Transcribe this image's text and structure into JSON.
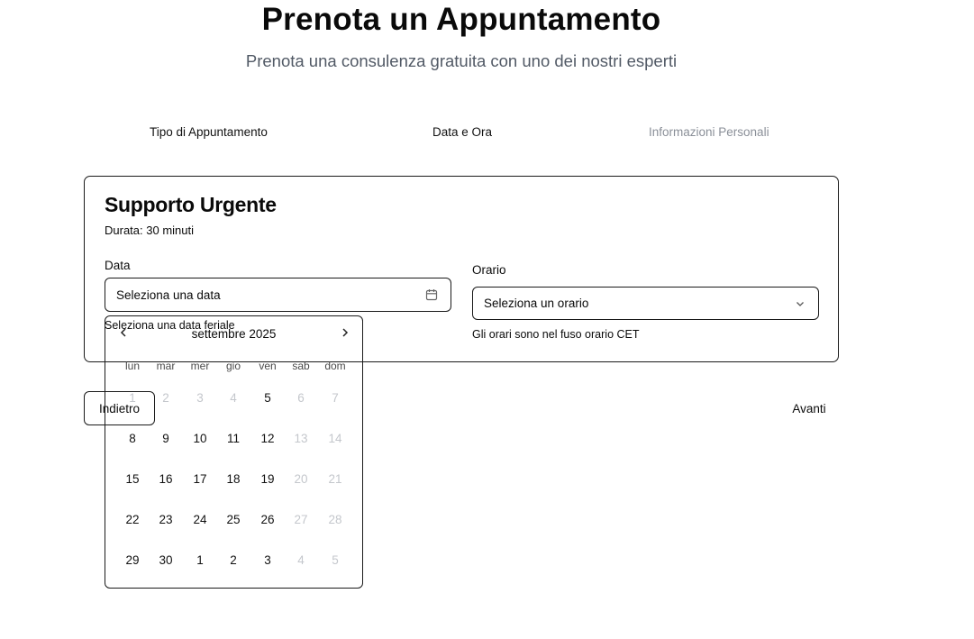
{
  "header": {
    "title": "Prenota un Appuntamento",
    "subtitle": "Prenota una consulenza gratuita con uno dei nostri esperti"
  },
  "steps": [
    {
      "label": "Tipo di Appuntamento",
      "state": "done"
    },
    {
      "label": "Data e Ora",
      "state": "active"
    },
    {
      "label": "Informazioni Personali",
      "state": "upcoming"
    }
  ],
  "card": {
    "title": "Supporto Urgente",
    "duration": "Durata: 30 minuti",
    "date_label": "Data",
    "date_placeholder": "Seleziona una data",
    "date_hint": "Seleziona una data feriale",
    "time_label": "Orario",
    "time_placeholder": "Seleziona un orario",
    "time_hint": "Gli orari sono nel fuso orario CET"
  },
  "nav": {
    "back": "Indietro",
    "next": "Avanti"
  },
  "calendar": {
    "month": "settembre 2025",
    "weekdays": [
      "lun",
      "mar",
      "mer",
      "gio",
      "ven",
      "sab",
      "dom"
    ],
    "weeks": [
      [
        {
          "d": "1",
          "off": true
        },
        {
          "d": "2",
          "off": true
        },
        {
          "d": "3",
          "off": true
        },
        {
          "d": "4",
          "off": true
        },
        {
          "d": "5",
          "off": false
        },
        {
          "d": "6",
          "off": true
        },
        {
          "d": "7",
          "off": true
        }
      ],
      [
        {
          "d": "8",
          "off": false
        },
        {
          "d": "9",
          "off": false
        },
        {
          "d": "10",
          "off": false
        },
        {
          "d": "11",
          "off": false
        },
        {
          "d": "12",
          "off": false
        },
        {
          "d": "13",
          "off": true
        },
        {
          "d": "14",
          "off": true
        }
      ],
      [
        {
          "d": "15",
          "off": false
        },
        {
          "d": "16",
          "off": false
        },
        {
          "d": "17",
          "off": false
        },
        {
          "d": "18",
          "off": false
        },
        {
          "d": "19",
          "off": false
        },
        {
          "d": "20",
          "off": true
        },
        {
          "d": "21",
          "off": true
        }
      ],
      [
        {
          "d": "22",
          "off": false
        },
        {
          "d": "23",
          "off": false
        },
        {
          "d": "24",
          "off": false
        },
        {
          "d": "25",
          "off": false
        },
        {
          "d": "26",
          "off": false
        },
        {
          "d": "27",
          "off": true
        },
        {
          "d": "28",
          "off": true
        }
      ],
      [
        {
          "d": "29",
          "off": false
        },
        {
          "d": "30",
          "off": false
        },
        {
          "d": "1",
          "off": false
        },
        {
          "d": "2",
          "off": false
        },
        {
          "d": "3",
          "off": false
        },
        {
          "d": "4",
          "off": true
        },
        {
          "d": "5",
          "off": true
        }
      ]
    ]
  },
  "colors": {
    "text": "#0a0a0a",
    "muted_text": "#8a8f98",
    "disabled_day": "#c4c7cc",
    "border": "#1a1a1a"
  },
  "icons": {
    "date_field": "calendar-icon",
    "time_field": "chevron-down-icon",
    "prev_month": "chevron-left-icon",
    "next_month": "chevron-right-icon"
  }
}
